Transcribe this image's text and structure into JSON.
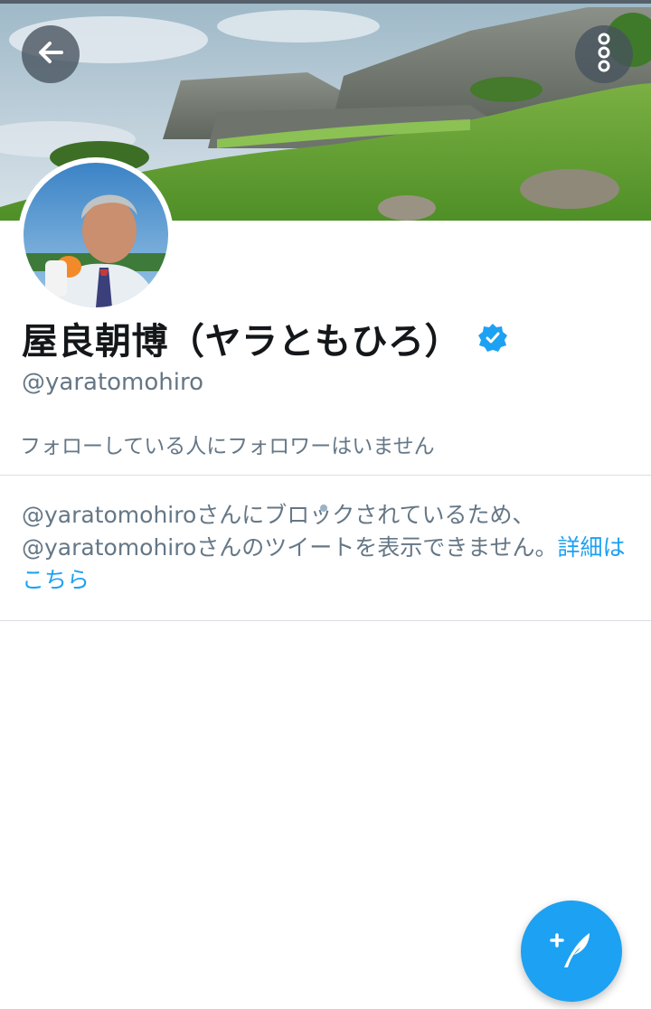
{
  "profile": {
    "display_name": "屋良朝博（ヤラともひろ）",
    "handle": "@yaratomohiro",
    "follow_note": "フォローしている人にフォロワーはいません",
    "verified": true
  },
  "blocked_notice": {
    "text": "@yaratomohiroさんにブロックされているため、@yaratomohiroさんのツイートを表示できません。",
    "link_label": "詳細はこちら"
  },
  "icons": {
    "back": "back-arrow-icon",
    "more": "more-vertical-icon",
    "verified": "verified-badge-icon",
    "compose": "compose-tweet-icon"
  },
  "colors": {
    "accent": "#1da1f2",
    "secondary_text": "#657786",
    "primary_text": "#14171a"
  }
}
